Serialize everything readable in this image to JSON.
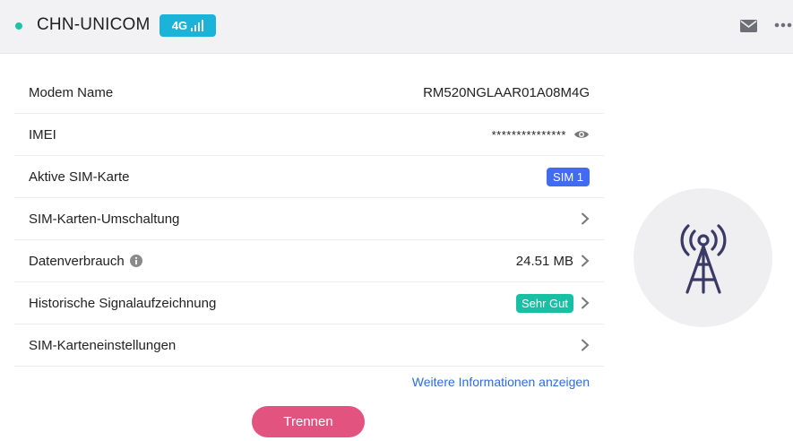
{
  "header": {
    "carrier": "CHN-UNICOM",
    "network_type": "4G",
    "status_color": "#1ec3a6",
    "badge_color": "#1cb3d8"
  },
  "rows": [
    {
      "label": "Modem Name",
      "value": "RM520NGLAAR01A08M4G"
    },
    {
      "label": "IMEI",
      "value": "***************"
    },
    {
      "label": "Aktive SIM-Karte",
      "value": "SIM 1"
    },
    {
      "label": "SIM-Karten-Umschaltung",
      "value": ""
    },
    {
      "label": "Datenverbrauch",
      "value": "24.51 MB"
    },
    {
      "label": "Historische Signalaufzeichnung",
      "value": "Sehr Gut"
    },
    {
      "label": "SIM-Karteneinstellungen",
      "value": ""
    }
  ],
  "more_info_link": "Weitere Informationen anzeigen",
  "disconnect_label": "Trennen",
  "icons": {
    "status": "status-dot-icon",
    "signal": "signal-bars-icon",
    "mail": "mail-icon",
    "more": "more-icon",
    "eye": "eye-icon",
    "info": "info-icon",
    "chevron": "chevron-right-icon",
    "tower": "cell-tower-icon"
  },
  "colors": {
    "sim_badge": "#3f6cf0",
    "good_badge": "#17c0a2",
    "link": "#2d6be0",
    "disconnect_button": "#e35380"
  }
}
